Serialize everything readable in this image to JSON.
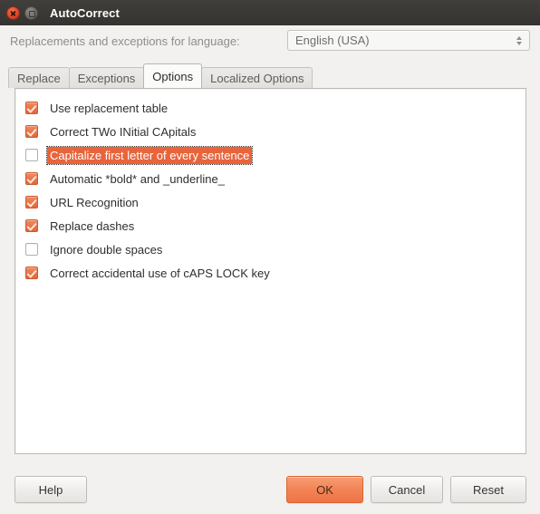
{
  "window": {
    "title": "AutoCorrect",
    "controls": {
      "close": "close-icon",
      "restore": "restore-icon"
    }
  },
  "language_row": {
    "label": "Replacements and exceptions for language:",
    "combo_value": "English (USA)",
    "spinner": "spinner-arrows-icon"
  },
  "tabs": [
    {
      "label": "Replace",
      "active": false
    },
    {
      "label": "Exceptions",
      "active": false
    },
    {
      "label": "Options",
      "active": true
    },
    {
      "label": "Localized Options",
      "active": false
    }
  ],
  "options": [
    {
      "label": "Use replacement table",
      "checked": true,
      "selected": false
    },
    {
      "label": "Correct TWo INitial CApitals",
      "checked": true,
      "selected": false
    },
    {
      "label": "Capitalize first letter of every sentence",
      "checked": false,
      "selected": true
    },
    {
      "label": "Automatic *bold* and _underline_",
      "checked": true,
      "selected": false
    },
    {
      "label": "URL Recognition",
      "checked": true,
      "selected": false
    },
    {
      "label": "Replace dashes",
      "checked": true,
      "selected": false
    },
    {
      "label": "Ignore double spaces",
      "checked": false,
      "selected": false
    },
    {
      "label": "Correct accidental use of cAPS LOCK key",
      "checked": true,
      "selected": false
    }
  ],
  "buttons": {
    "help": "Help",
    "ok": "OK",
    "cancel": "Cancel",
    "reset": "Reset"
  },
  "colors": {
    "accent": "#e8643b",
    "ok_button": "#f28355",
    "titlebar": "#3a3835",
    "panel_bg": "#ffffff",
    "window_bg": "#f2f1f0"
  }
}
